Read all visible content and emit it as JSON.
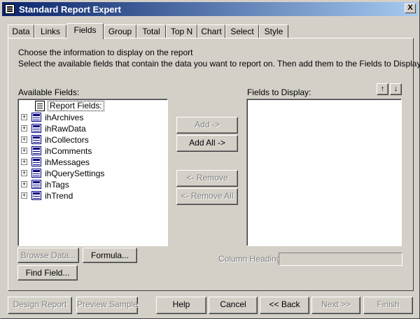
{
  "window": {
    "title": "Standard Report Expert",
    "close_glyph": "X"
  },
  "tabs": [
    {
      "label": "Data"
    },
    {
      "label": "Links"
    },
    {
      "label": "Fields"
    },
    {
      "label": "Group"
    },
    {
      "label": "Total"
    },
    {
      "label": "Top N"
    },
    {
      "label": "Chart"
    },
    {
      "label": "Select"
    },
    {
      "label": "Style"
    }
  ],
  "active_tab": "Fields",
  "instructions": {
    "line1": "Choose the information to display on the report",
    "line2": "Select the available fields that contain the data you want to report on.  Then add them to the Fields to Display list."
  },
  "available": {
    "label": "Available Fields:",
    "root": "Report Fields:",
    "items": [
      "ihArchives",
      "ihRawData",
      "ihCollectors",
      "ihComments",
      "ihMessages",
      "ihQuerySettings",
      "ihTags",
      "ihTrend"
    ]
  },
  "display": {
    "label": "Fields to Display:",
    "move_up": "↑",
    "move_down": "↓"
  },
  "mid_buttons": {
    "add": "Add ->",
    "add_all": "Add All ->",
    "remove": "<- Remove",
    "remove_all": "<- Remove All"
  },
  "left_buttons": {
    "browse": "Browse Data...",
    "formula": "Formula...",
    "find": "Find Field..."
  },
  "column_heading": {
    "label": "Column Heading:",
    "value": ""
  },
  "footer": {
    "design": "Design Report",
    "preview": "Preview Sample",
    "help": "Help",
    "cancel": "Cancel",
    "back": "<< Back",
    "next": "Next >>",
    "finish": "Finish"
  }
}
